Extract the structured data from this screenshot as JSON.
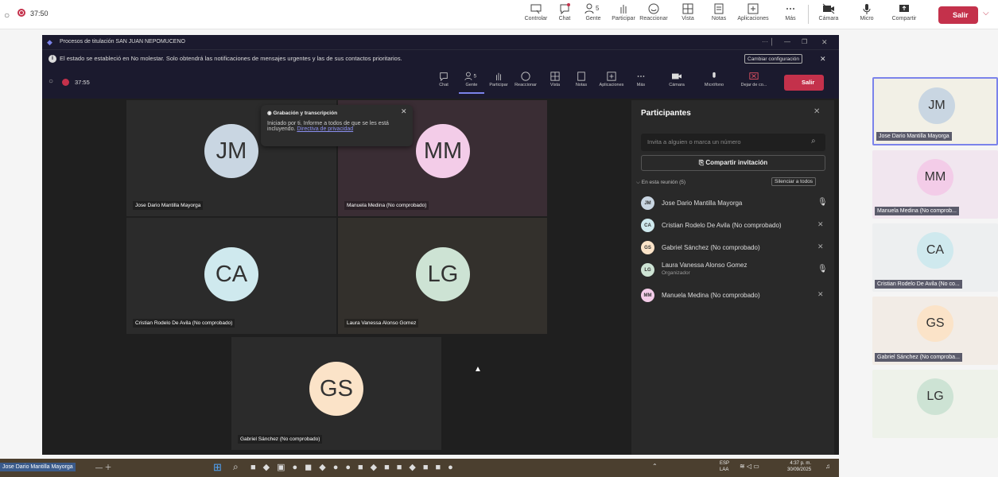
{
  "top": {
    "timer": "37:50",
    "buttons": [
      "Controlar",
      "Chat",
      "Gente",
      "Participar",
      "Reaccionar",
      "Vista",
      "Notas",
      "Aplicaciones",
      "Más",
      "Cámara",
      "Micro",
      "Compartir"
    ],
    "people_count": "5",
    "leave": "Salir"
  },
  "window": {
    "title": "Procesos de titulación SAN JUAN NEPOMUCENO",
    "notice": "El estado se estableció en No molestar. Solo obtendrá las notificaciones de mensajes urgentes y las de sus contactos prioritarios.",
    "notice_button": "Cambiar configuración",
    "timer": "37:55",
    "buttons": [
      "Chat",
      "Gente",
      "Participar",
      "Reaccionar",
      "Vista",
      "Notas",
      "Aplicaciones",
      "Más",
      "Cámara",
      "Micrófono",
      "Dejar de co..."
    ],
    "people_count": "5",
    "leave": "Salir"
  },
  "popup": {
    "title": "Grabación y transcripción",
    "text": "Iniciado por ti. Informe a todos de que se les está incluyendo.",
    "link": "Directiva de privacidad"
  },
  "tiles": [
    {
      "initials": "JM",
      "name": "Jose Dario Mantilla Mayorga",
      "color": "#c9d6e2"
    },
    {
      "initials": "MM",
      "name": "Manuela Medina (No comprobado)",
      "color": "#f3cce8"
    },
    {
      "initials": "CA",
      "name": "Cristian Rodelo De Avila (No comprobado)",
      "color": "#cfe9ee"
    },
    {
      "initials": "LG",
      "name": "Laura Vanessa Alonso Gomez",
      "color": "#cde3d4"
    },
    {
      "initials": "GS",
      "name": "Gabriel Sánchez (No comprobado)",
      "color": "#fbe3c8"
    }
  ],
  "panel": {
    "title": "Participantes",
    "invite_placeholder": "Invita a alguien o marca un número",
    "share": "Compartir invitación",
    "section": "En esta reunión (5)",
    "mute_all": "Silenciar a todos",
    "people": [
      {
        "initials": "JM",
        "name": "Jose Dario Mantilla Mayorga",
        "sub": "",
        "color": "#c9d6e2"
      },
      {
        "initials": "CA",
        "name": "Cristian Rodelo De Avila (No comprobado)",
        "sub": "",
        "color": "#cfe9ee"
      },
      {
        "initials": "GS",
        "name": "Gabriel Sánchez (No comprobado)",
        "sub": "",
        "color": "#fbe3c8"
      },
      {
        "initials": "LG",
        "name": "Laura Vanessa Alonso Gomez",
        "sub": "Organizador",
        "color": "#cde3d4"
      },
      {
        "initials": "MM",
        "name": "Manuela Medina (No comprobado)",
        "sub": "",
        "color": "#f3cce8"
      }
    ]
  },
  "rail": [
    {
      "initials": "JM",
      "name": "Jose Dario Mantilla Mayorga",
      "color": "#c9d6e2"
    },
    {
      "initials": "MM",
      "name": "Manuela Medina (No comprob...",
      "color": "#f3cce8"
    },
    {
      "initials": "CA",
      "name": "Cristian Rodelo De Avila (No co...",
      "color": "#cfe9ee"
    },
    {
      "initials": "GS",
      "name": "Gabriel Sánchez (No comproba...",
      "color": "#fbe3c8"
    },
    {
      "initials": "LG",
      "name": "",
      "color": "#cde3d4"
    }
  ],
  "taskbar": {
    "user": "Jose Dario Mantilla Mayorga",
    "lang": "ESP",
    "lang2": "LAA",
    "time": "4:37 p. m.",
    "date": "30/09/2025"
  }
}
